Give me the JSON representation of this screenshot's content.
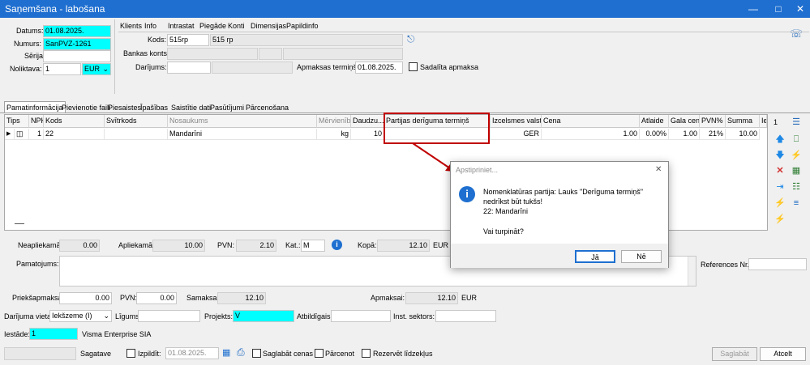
{
  "window": {
    "title": "Saņemšana - labošana"
  },
  "header_left": {
    "date_label": "Datums:",
    "date_value": "01.08.2025.",
    "number_label": "Numurs:",
    "number_value": "SanPVZ-1261",
    "series_label": "Sērija:",
    "series_value": "",
    "warehouse_label": "Noliktava:",
    "warehouse_value": "1",
    "currency_value": "EUR"
  },
  "client_tabs": [
    "Klients",
    "Info",
    "Intrastat",
    "Piegāde",
    "Konti",
    "Dimensijas",
    "Papildinfo"
  ],
  "client": {
    "code_label": "Kods:",
    "code_value": "515rp",
    "name_value": "515 rp",
    "bank_label": "Bankas konts:",
    "deal_label": "Darījums:",
    "due_label": "Apmaksas termiņš:",
    "due_value": "01.08.2025.",
    "split_label": "Sadalīta apmaksa"
  },
  "main_tabs": [
    "Pamatinformācija",
    "Pievienotie faili",
    "Piesaistes",
    "Īpašības",
    "Saistītie dati",
    "Pasūtījumi",
    "Pārcenošana"
  ],
  "grid": {
    "headers": [
      "Tips",
      "NPK",
      "Kods",
      "Svītrkods",
      "Nosaukums",
      "Mērvienība",
      "Daudzu...",
      "Partijas derīguma termiņš",
      "Izcelsmes valsts",
      "Cena",
      "Atlaide",
      "Gala cena",
      "PVN%",
      "Summa",
      "Ie"
    ],
    "row": {
      "npk": "1",
      "code": "22",
      "barcode": "",
      "name": "Mandarīni",
      "unit": "kg",
      "qty": "10",
      "batch_expiry": "",
      "origin": "GER",
      "price": "1.00",
      "discount": "0.00%",
      "final_price": "1.00",
      "vat": "21%",
      "sum": "10.00"
    },
    "side_count": "1"
  },
  "totals": {
    "non_taxable_label": "Neapliekamā:",
    "non_taxable_value": "0.00",
    "taxable_label": "Apliekamā:",
    "taxable_value": "10.00",
    "vat_label": "PVN:",
    "vat_value": "2.10",
    "cat_label": "Kat.:",
    "cat_value": "M",
    "total_label": "Kopā:",
    "total_value": "12.10",
    "currency": "EUR"
  },
  "basis_label": "Pamatojums:",
  "references_label": "References Nr.:",
  "payments": {
    "prepay_label": "Priekšapmaksa:",
    "prepay_value": "0.00",
    "pvn_label": "PVN:",
    "pvn_value": "0.00",
    "paid_label": "Samaksai:",
    "paid_value": "12.10",
    "to_pay_label": "Apmaksai:",
    "to_pay_value": "12.10",
    "currency": "EUR"
  },
  "deal": {
    "place_label": "Darījuma vieta:",
    "place_value": "Iekšzeme (I)",
    "contract_label": "Līgums:",
    "project_label": "Projekts:",
    "project_value": "V",
    "responsible_label": "Atbildīgais:",
    "sector_label": "Inst. sektors:"
  },
  "institution": {
    "label": "Iestāde:",
    "code": "1",
    "name": "Visma Enterprise SIA"
  },
  "footer": {
    "status": "Sagatave",
    "execute_label": "Izpildīt:",
    "execute_date": "01.08.2025.",
    "save_prices": "Saglabāt cenas",
    "reprice": "Pārcenot",
    "reserve": "Rezervēt līdzekļus",
    "save_button": "Saglabāt",
    "cancel_button": "Atcelt"
  },
  "dialog": {
    "title": "Apstipriniet...",
    "line1": "Nomenklatūras partija: Lauks \"Derīguma termiņš\"",
    "line2": "nedrīkst būt tukšs!",
    "line3": "22: Mandarīni",
    "question": "Vai turpināt?",
    "yes": "Jā",
    "no": "Nē"
  },
  "colors": {
    "titlebar": "#1f6fd0",
    "highlight": "#00ffff",
    "annotation": "#c00000"
  }
}
